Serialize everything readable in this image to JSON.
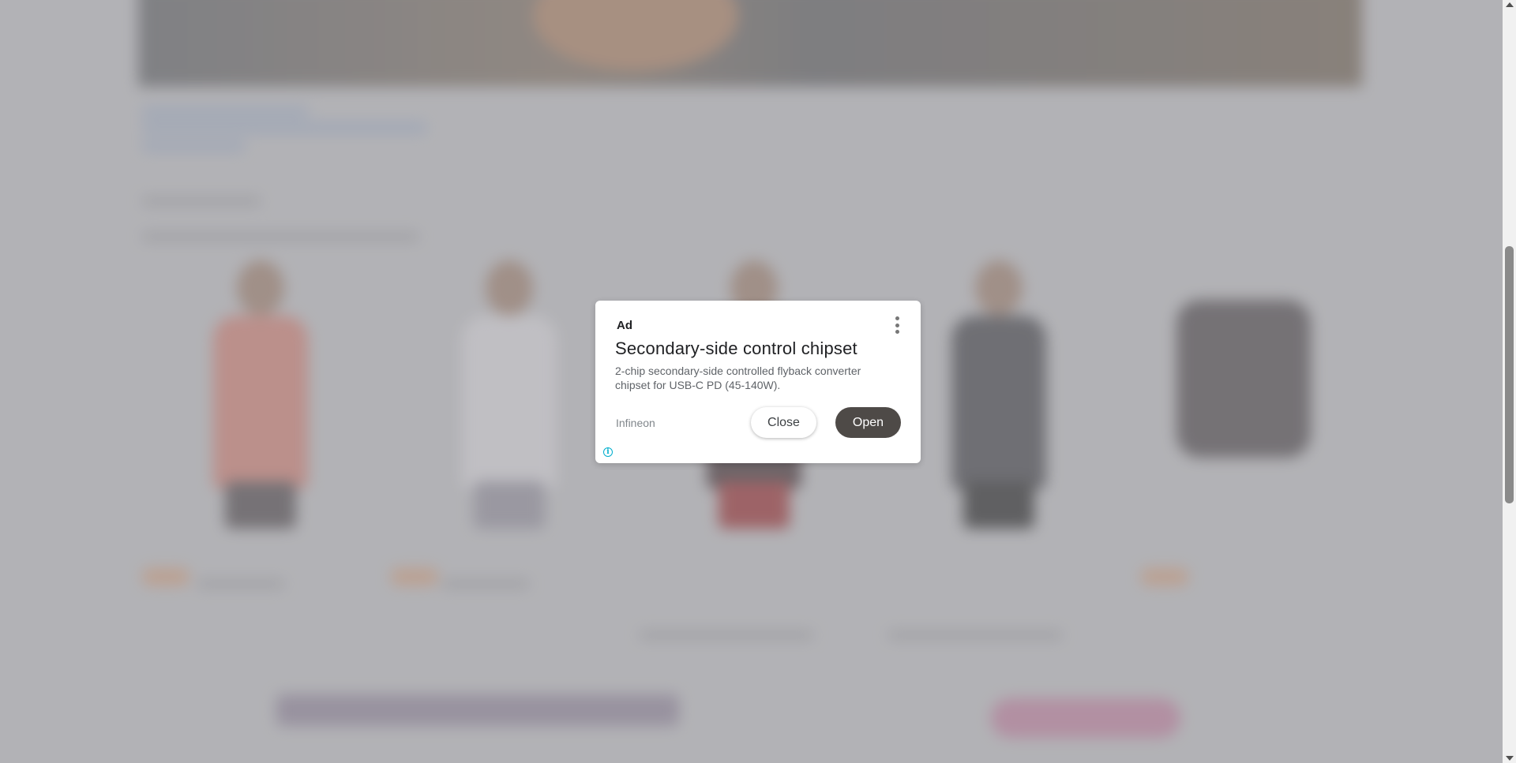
{
  "ad": {
    "label": "Ad",
    "title": "Secondary-side control chipset",
    "description": "2-chip secondary-side controlled flyback converter chipset for USB-C PD (45-140W).",
    "advertiser": "Infineon",
    "close_label": "Close",
    "open_label": "Open",
    "info_glyph": "i",
    "menu_icon": "more-vert-icon",
    "info_icon": "info-icon"
  },
  "colors": {
    "open_button_bg": "#4e4a47",
    "info_accent": "#00aecd",
    "overlay": "rgba(150,150,155,0.45)"
  }
}
